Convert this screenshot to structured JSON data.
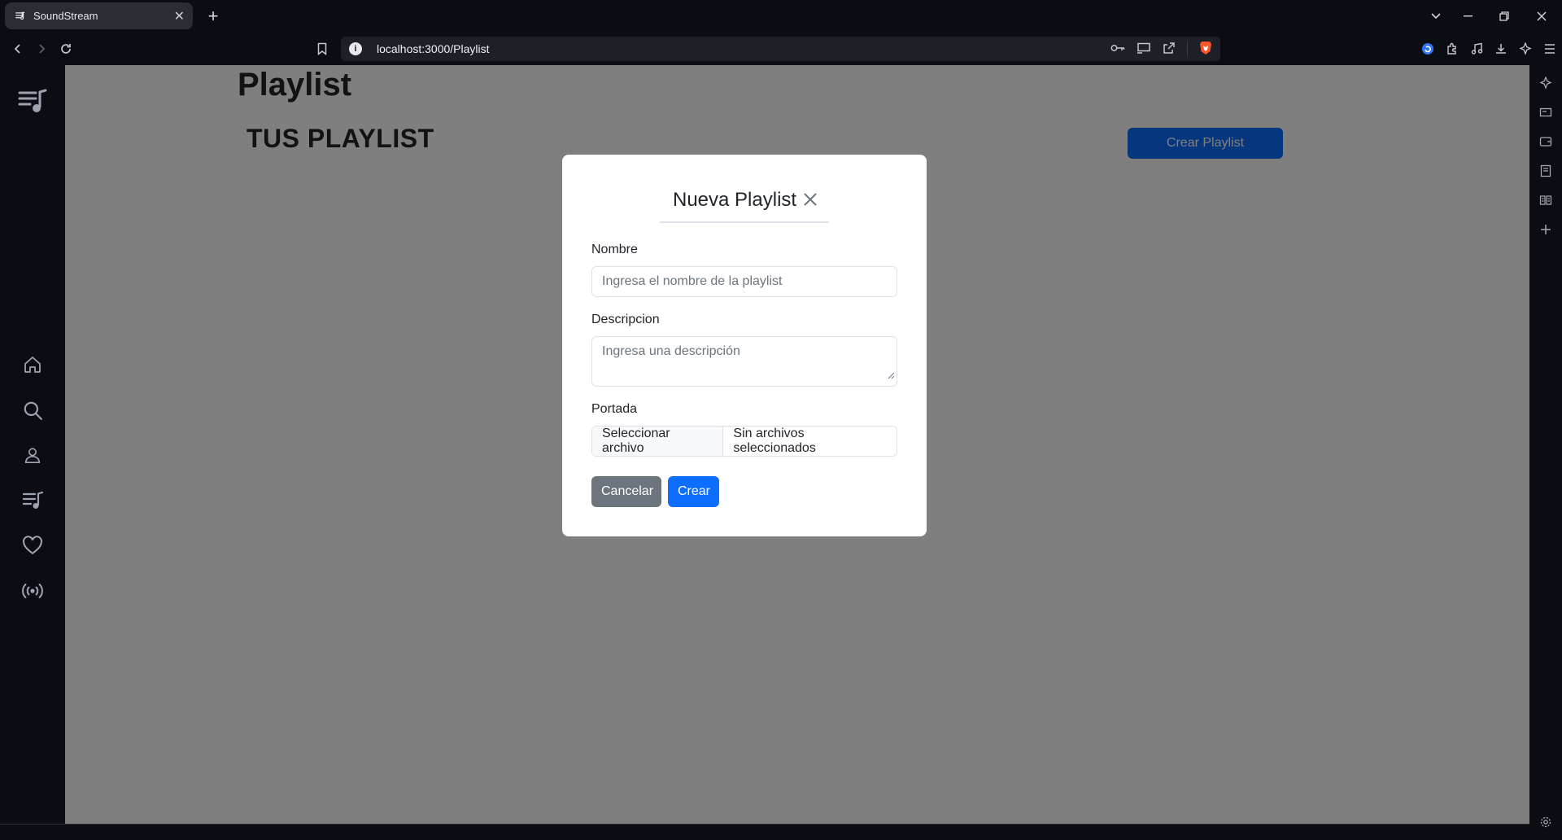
{
  "browser": {
    "tab_title": "SoundStream",
    "url": "localhost:3000/Playlist",
    "icons": [
      "back-icon",
      "forward-icon",
      "reload-icon",
      "bookmark-icon",
      "site-info-icon",
      "password-key-icon",
      "cast-icon",
      "share-icon",
      "brave-shields-icon",
      "extension-icon",
      "puzzle-icon",
      "music-icon",
      "download-icon",
      "leo-ai-icon",
      "menu-icon"
    ]
  },
  "sidebar": {
    "items": [
      {
        "name": "home",
        "icon": "home-icon"
      },
      {
        "name": "search",
        "icon": "search-icon"
      },
      {
        "name": "profile",
        "icon": "user-icon"
      },
      {
        "name": "playlists",
        "icon": "playlist-icon"
      },
      {
        "name": "favorites",
        "icon": "heart-icon"
      },
      {
        "name": "podcasts",
        "icon": "broadcast-icon"
      }
    ]
  },
  "page": {
    "title": "Playlist",
    "section_title": "TUS PLAYLIST",
    "create_button": "Crear Playlist"
  },
  "modal": {
    "title": "Nueva Playlist",
    "nombre_label": "Nombre",
    "nombre_placeholder": "Ingresa el nombre de la playlist",
    "descripcion_label": "Descripcion",
    "descripcion_placeholder": "Ingresa una descripción",
    "portada_label": "Portada",
    "file_button": "Seleccionar archivo",
    "file_status": "Sin archivos seleccionados",
    "cancel_button": "Cancelar",
    "create_button": "Crear"
  },
  "colors": {
    "primary": "#0d6efd",
    "secondary": "#6c757d",
    "chrome": "#0b0d12"
  }
}
